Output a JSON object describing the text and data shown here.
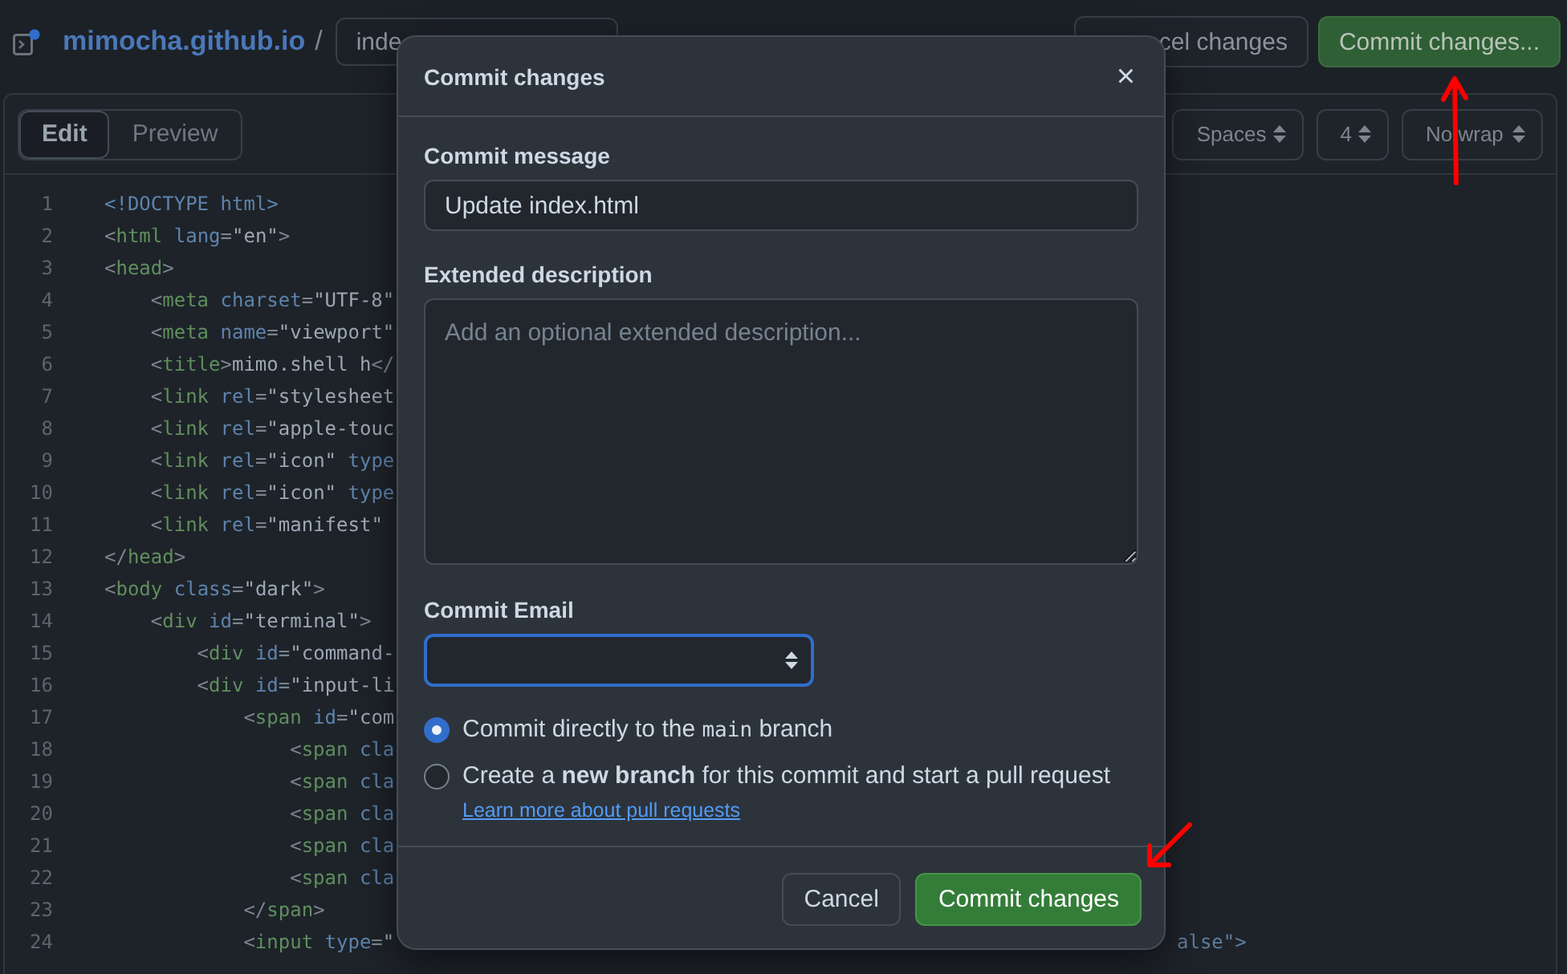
{
  "header": {
    "repo": "mimocha.github.io",
    "separator": "/",
    "filename": "inde",
    "cancel_button": "cel changes",
    "commit_button": "Commit changes..."
  },
  "editor": {
    "tabs": [
      {
        "label": "Edit",
        "selected": true
      },
      {
        "label": "Preview",
        "selected": false
      }
    ],
    "selects": [
      "Spaces",
      "4",
      "No wrap"
    ],
    "lines": [
      {
        "number": "1",
        "tokens": [
          {
            "kind": "doctype",
            "text": "<!DOCTYPE html>"
          }
        ]
      },
      {
        "number": "2",
        "tokens": [
          {
            "kind": "punct",
            "text": "<"
          },
          {
            "kind": "tag",
            "text": "html"
          },
          {
            "kind": "attr",
            "text": " lang"
          },
          {
            "kind": "punct",
            "text": "="
          },
          {
            "kind": "str",
            "text": "\"en\""
          },
          {
            "kind": "punct",
            "text": ">"
          }
        ]
      },
      {
        "number": "3",
        "tokens": [
          {
            "kind": "punct",
            "text": "<"
          },
          {
            "kind": "tag",
            "text": "head"
          },
          {
            "kind": "punct",
            "text": ">"
          }
        ]
      },
      {
        "number": "4",
        "tokens": [
          {
            "kind": "punct",
            "text": "    <"
          },
          {
            "kind": "tag",
            "text": "meta"
          },
          {
            "kind": "attr",
            "text": " charset"
          },
          {
            "kind": "punct",
            "text": "="
          },
          {
            "kind": "str",
            "text": "\"UTF-8\""
          }
        ]
      },
      {
        "number": "5",
        "tokens": [
          {
            "kind": "punct",
            "text": "    <"
          },
          {
            "kind": "tag",
            "text": "meta"
          },
          {
            "kind": "attr",
            "text": " name"
          },
          {
            "kind": "punct",
            "text": "="
          },
          {
            "kind": "str",
            "text": "\"viewport\""
          }
        ]
      },
      {
        "number": "6",
        "tokens": [
          {
            "kind": "punct",
            "text": "    <"
          },
          {
            "kind": "tag",
            "text": "title"
          },
          {
            "kind": "punct",
            "text": ">"
          },
          {
            "kind": "text",
            "text": "mimo.shell h"
          },
          {
            "kind": "punct",
            "text": "</"
          }
        ]
      },
      {
        "number": "7",
        "tokens": [
          {
            "kind": "punct",
            "text": "    <"
          },
          {
            "kind": "tag",
            "text": "link"
          },
          {
            "kind": "attr",
            "text": " rel"
          },
          {
            "kind": "punct",
            "text": "="
          },
          {
            "kind": "str",
            "text": "\"stylesheet"
          }
        ]
      },
      {
        "number": "8",
        "tokens": [
          {
            "kind": "punct",
            "text": "    <"
          },
          {
            "kind": "tag",
            "text": "link"
          },
          {
            "kind": "attr",
            "text": " rel"
          },
          {
            "kind": "punct",
            "text": "="
          },
          {
            "kind": "str",
            "text": "\"apple-touc"
          }
        ]
      },
      {
        "number": "9",
        "tokens": [
          {
            "kind": "punct",
            "text": "    <"
          },
          {
            "kind": "tag",
            "text": "link"
          },
          {
            "kind": "attr",
            "text": " rel"
          },
          {
            "kind": "punct",
            "text": "="
          },
          {
            "kind": "str",
            "text": "\"icon\""
          },
          {
            "kind": "attr",
            "text": " type"
          }
        ]
      },
      {
        "number": "10",
        "tokens": [
          {
            "kind": "punct",
            "text": "    <"
          },
          {
            "kind": "tag",
            "text": "link"
          },
          {
            "kind": "attr",
            "text": " rel"
          },
          {
            "kind": "punct",
            "text": "="
          },
          {
            "kind": "str",
            "text": "\"icon\""
          },
          {
            "kind": "attr",
            "text": " type"
          }
        ]
      },
      {
        "number": "11",
        "tokens": [
          {
            "kind": "punct",
            "text": "    <"
          },
          {
            "kind": "tag",
            "text": "link"
          },
          {
            "kind": "attr",
            "text": " rel"
          },
          {
            "kind": "punct",
            "text": "="
          },
          {
            "kind": "str",
            "text": "\"manifest\""
          }
        ]
      },
      {
        "number": "12",
        "tokens": [
          {
            "kind": "punct",
            "text": "</"
          },
          {
            "kind": "tag",
            "text": "head"
          },
          {
            "kind": "punct",
            "text": ">"
          }
        ]
      },
      {
        "number": "13",
        "tokens": [
          {
            "kind": "punct",
            "text": "<"
          },
          {
            "kind": "tag",
            "text": "body"
          },
          {
            "kind": "attr",
            "text": " class"
          },
          {
            "kind": "punct",
            "text": "="
          },
          {
            "kind": "str",
            "text": "\"dark\""
          },
          {
            "kind": "punct",
            "text": ">"
          }
        ]
      },
      {
        "number": "14",
        "tokens": [
          {
            "kind": "punct",
            "text": "    <"
          },
          {
            "kind": "tag",
            "text": "div"
          },
          {
            "kind": "attr",
            "text": " id"
          },
          {
            "kind": "punct",
            "text": "="
          },
          {
            "kind": "str",
            "text": "\"terminal\""
          },
          {
            "kind": "punct",
            "text": ">"
          }
        ]
      },
      {
        "number": "15",
        "tokens": [
          {
            "kind": "punct",
            "text": "        <"
          },
          {
            "kind": "tag",
            "text": "div"
          },
          {
            "kind": "attr",
            "text": " id"
          },
          {
            "kind": "punct",
            "text": "="
          },
          {
            "kind": "str",
            "text": "\"command-"
          }
        ]
      },
      {
        "number": "16",
        "tokens": [
          {
            "kind": "punct",
            "text": "        <"
          },
          {
            "kind": "tag",
            "text": "div"
          },
          {
            "kind": "attr",
            "text": " id"
          },
          {
            "kind": "punct",
            "text": "="
          },
          {
            "kind": "str",
            "text": "\"input-li"
          }
        ]
      },
      {
        "number": "17",
        "tokens": [
          {
            "kind": "punct",
            "text": "            <"
          },
          {
            "kind": "tag",
            "text": "span"
          },
          {
            "kind": "attr",
            "text": " id"
          },
          {
            "kind": "punct",
            "text": "="
          },
          {
            "kind": "str",
            "text": "\"com"
          }
        ]
      },
      {
        "number": "18",
        "tokens": [
          {
            "kind": "punct",
            "text": "                <"
          },
          {
            "kind": "tag",
            "text": "span"
          },
          {
            "kind": "attr",
            "text": " cla"
          }
        ]
      },
      {
        "number": "19",
        "tokens": [
          {
            "kind": "punct",
            "text": "                <"
          },
          {
            "kind": "tag",
            "text": "span"
          },
          {
            "kind": "attr",
            "text": " cla"
          }
        ]
      },
      {
        "number": "20",
        "tokens": [
          {
            "kind": "punct",
            "text": "                <"
          },
          {
            "kind": "tag",
            "text": "span"
          },
          {
            "kind": "attr",
            "text": " cla"
          }
        ]
      },
      {
        "number": "21",
        "tokens": [
          {
            "kind": "punct",
            "text": "                <"
          },
          {
            "kind": "tag",
            "text": "span"
          },
          {
            "kind": "attr",
            "text": " cla"
          }
        ]
      },
      {
        "number": "22",
        "tokens": [
          {
            "kind": "punct",
            "text": "                <"
          },
          {
            "kind": "tag",
            "text": "span"
          },
          {
            "kind": "attr",
            "text": " cla"
          }
        ]
      },
      {
        "number": "23",
        "tokens": [
          {
            "kind": "punct",
            "text": "            </"
          },
          {
            "kind": "tag",
            "text": "span"
          },
          {
            "kind": "punct",
            "text": ">"
          }
        ]
      },
      {
        "number": "24",
        "tokens": [
          {
            "kind": "punct",
            "text": "            <"
          },
          {
            "kind": "tag",
            "text": "input"
          },
          {
            "kind": "attr",
            "text": " type"
          },
          {
            "kind": "punct",
            "text": "="
          },
          {
            "kind": "str",
            "text": "\""
          }
        ],
        "tail": "alse\">"
      }
    ]
  },
  "dialog": {
    "title": "Commit changes",
    "close": "×",
    "message_label": "Commit message",
    "message_value": "Update index.html",
    "description_label": "Extended description",
    "description_placeholder": "Add an optional extended description...",
    "email_label": "Commit Email",
    "email_focused": true,
    "options": [
      {
        "selected": true,
        "parts": [
          {
            "kind": "text",
            "text": "Commit directly to the "
          },
          {
            "kind": "code",
            "text": "main"
          },
          {
            "kind": "text",
            "text": " branch"
          }
        ]
      },
      {
        "selected": false,
        "parts": [
          {
            "kind": "text",
            "text": "Create a **new branch** for this commit and start a pull request"
          }
        ],
        "link": "Learn more about pull requests"
      }
    ],
    "buttons": [
      {
        "label": "Cancel",
        "kind": "secondary"
      },
      {
        "label": "Commit changes",
        "kind": "primary"
      }
    ]
  }
}
